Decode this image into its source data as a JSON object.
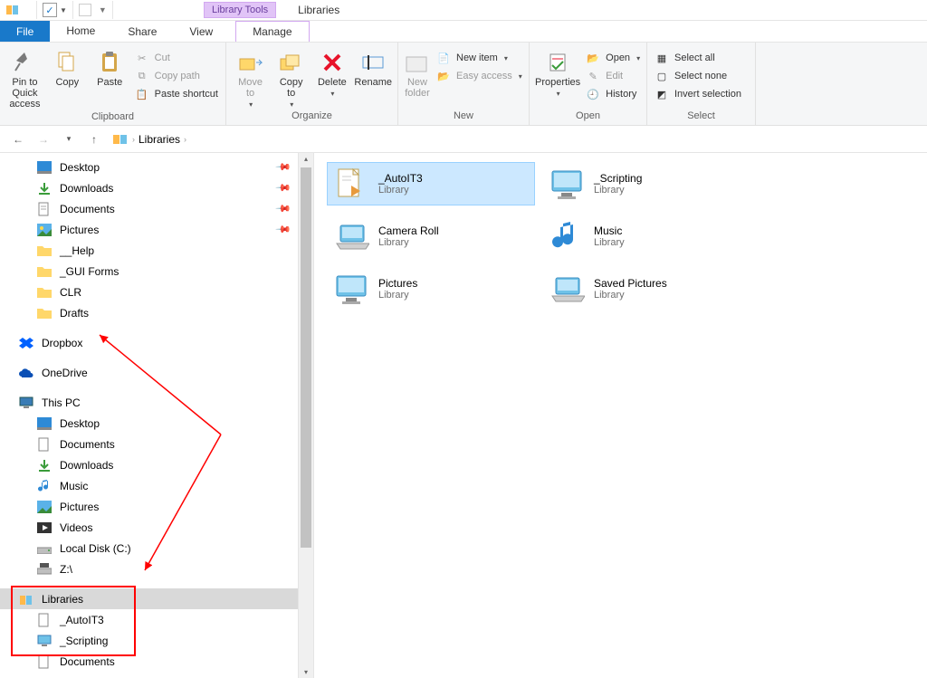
{
  "title": {
    "context_label": "Library Tools",
    "window_title": "Libraries"
  },
  "tabs": {
    "file": "File",
    "home": "Home",
    "share": "Share",
    "view": "View",
    "manage": "Manage"
  },
  "ribbon": {
    "clipboard": {
      "pin": "Pin to Quick\naccess",
      "copy": "Copy",
      "paste": "Paste",
      "cut": "Cut",
      "copy_path": "Copy path",
      "paste_shortcut": "Paste shortcut",
      "label": "Clipboard"
    },
    "organize": {
      "move": "Move\nto",
      "copy": "Copy\nto",
      "delete": "Delete",
      "rename": "Rename",
      "label": "Organize"
    },
    "new": {
      "new_folder": "New\nfolder",
      "new_item": "New item",
      "easy_access": "Easy access",
      "label": "New"
    },
    "open": {
      "properties": "Properties",
      "open": "Open",
      "edit": "Edit",
      "history": "History",
      "label": "Open"
    },
    "select": {
      "select_all": "Select all",
      "select_none": "Select none",
      "invert": "Invert selection",
      "label": "Select"
    }
  },
  "address": {
    "crumb1": "Libraries"
  },
  "tree": {
    "desktop": "Desktop",
    "downloads": "Downloads",
    "documents": "Documents",
    "pictures": "Pictures",
    "help": "__Help",
    "gui": "_GUI Forms",
    "clr": "CLR",
    "drafts": "Drafts",
    "dropbox": "Dropbox",
    "onedrive": "OneDrive",
    "thispc": "This PC",
    "pc_desktop": "Desktop",
    "pc_documents": "Documents",
    "pc_downloads": "Downloads",
    "pc_music": "Music",
    "pc_pictures": "Pictures",
    "pc_videos": "Videos",
    "pc_localc": "Local Disk (C:)",
    "pc_z": "Z:\\",
    "libraries": "Libraries",
    "lib_autoit": "_AutoIT3",
    "lib_scripting": "_Scripting",
    "lib_documents": "Documents"
  },
  "items": [
    {
      "name": "_AutoIT3",
      "sub": "Library",
      "icon": "doc",
      "selected": true
    },
    {
      "name": "_Scripting",
      "sub": "Library",
      "icon": "monitor",
      "selected": false
    },
    {
      "name": "Camera Roll",
      "sub": "Library",
      "icon": "laptop",
      "selected": false
    },
    {
      "name": "Music",
      "sub": "Library",
      "icon": "music",
      "selected": false
    },
    {
      "name": "Pictures",
      "sub": "Library",
      "icon": "monitor",
      "selected": false
    },
    {
      "name": "Saved Pictures",
      "sub": "Library",
      "icon": "laptop",
      "selected": false
    }
  ]
}
